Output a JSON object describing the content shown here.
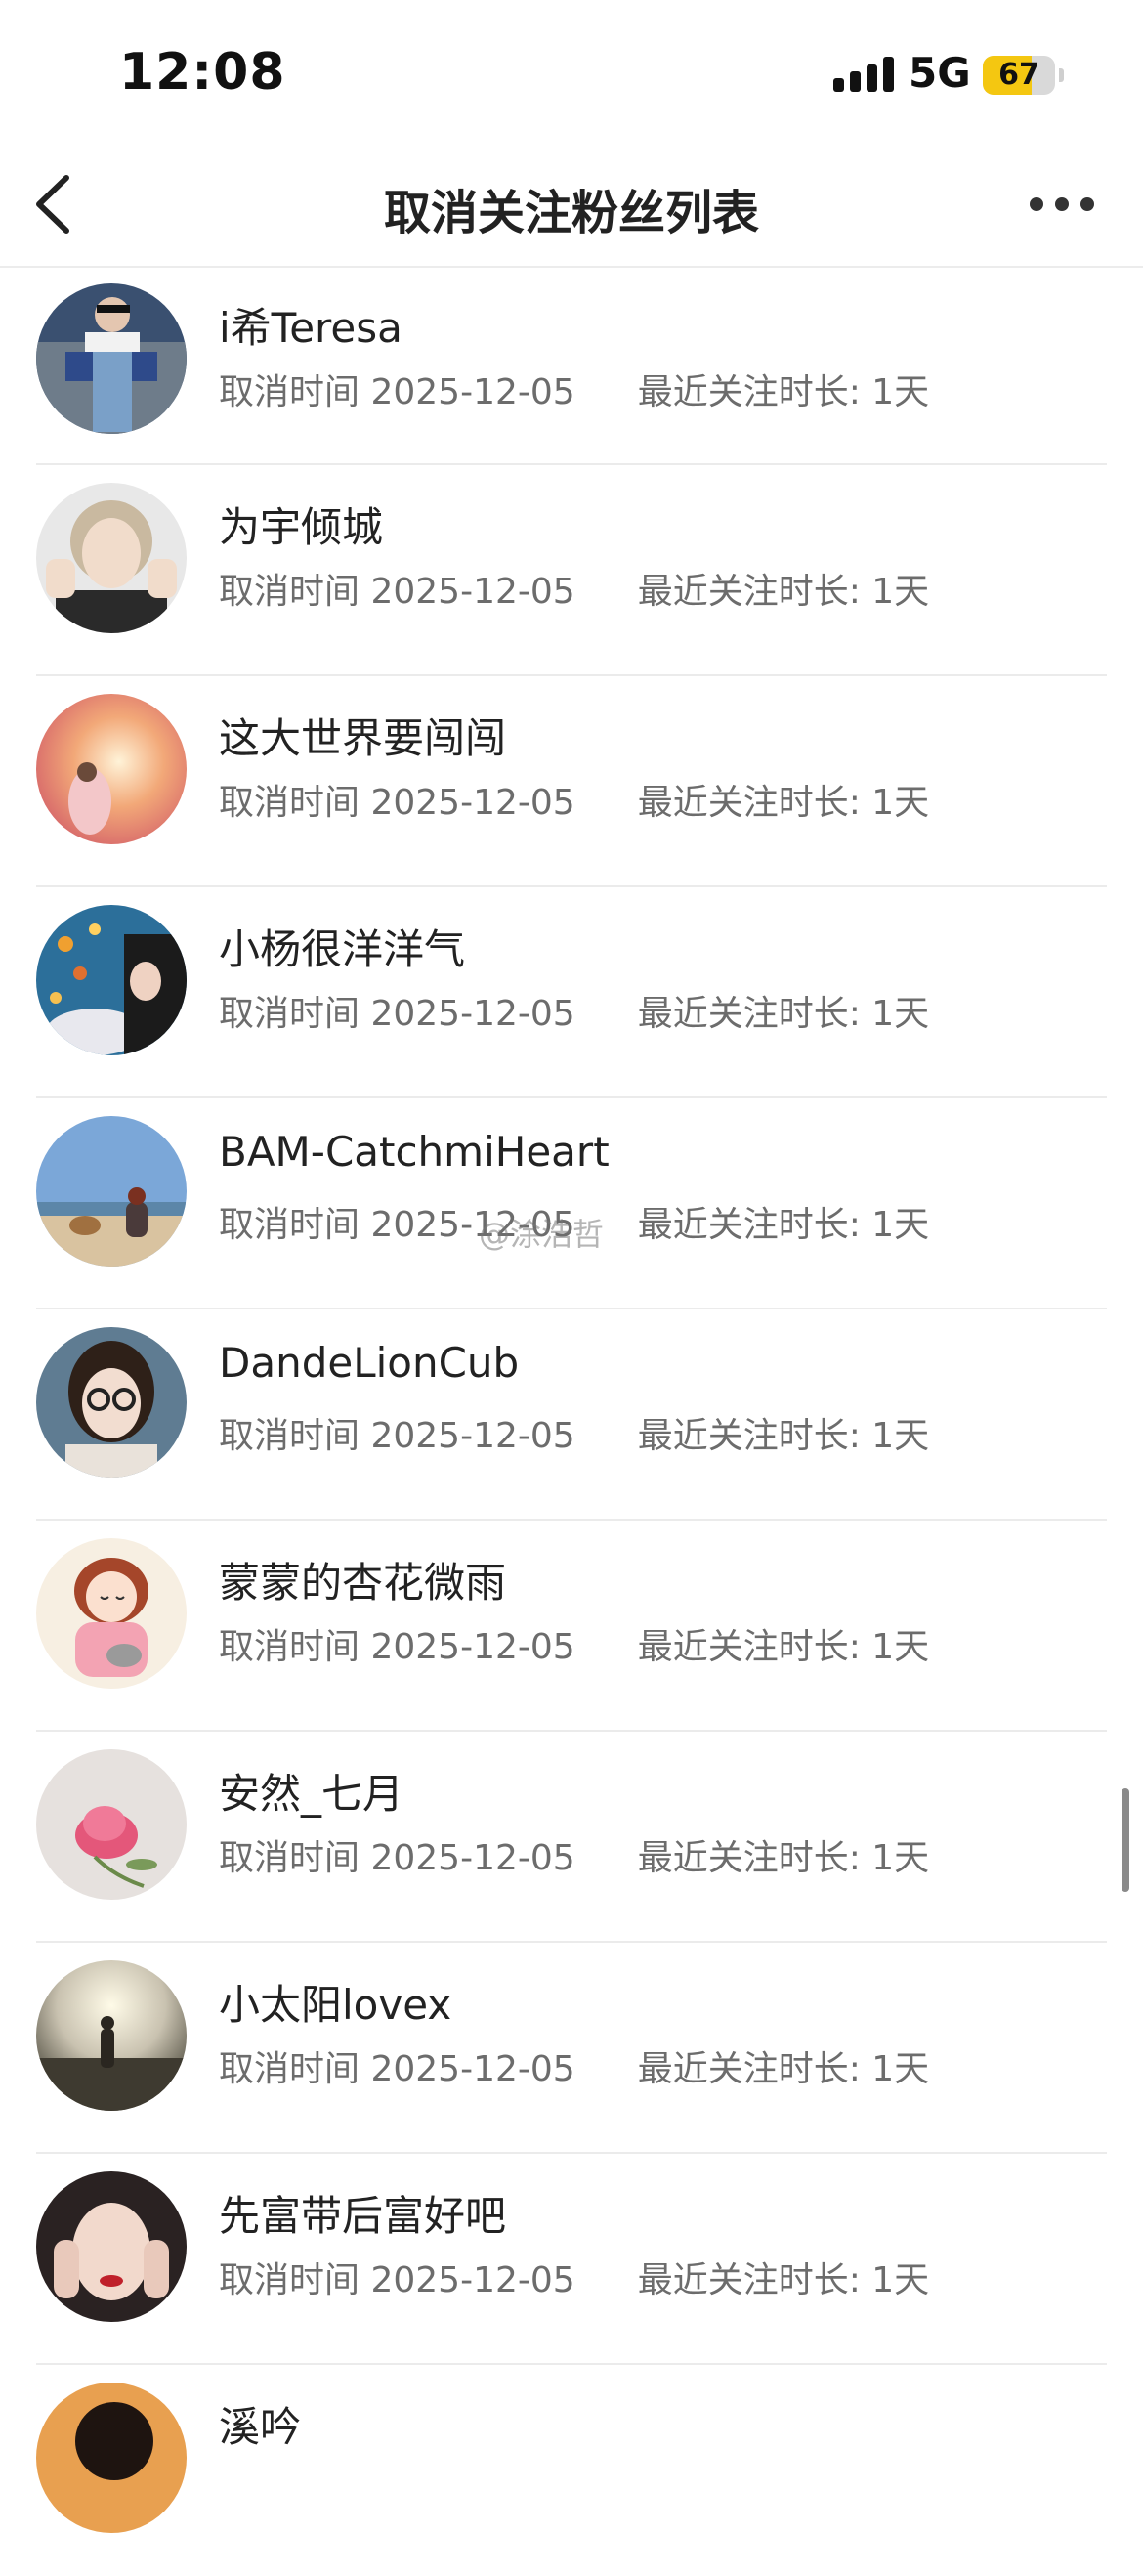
{
  "status_bar": {
    "time": "12:08",
    "network": "5G",
    "battery": "67",
    "battery_level": 0.67
  },
  "header": {
    "title": "取消关注粉丝列表",
    "back_icon": "chevron-left-icon",
    "more_icon": "more-dots-icon"
  },
  "list": {
    "items": [
      {
        "name": "i希Teresa",
        "cancel_label": "取消时间",
        "cancel_date": "2025-12-05",
        "duration_label": "最近关注时长:",
        "duration": "1天"
      },
      {
        "name": "为宇倾城",
        "cancel_label": "取消时间",
        "cancel_date": "2025-12-05",
        "duration_label": "最近关注时长:",
        "duration": "1天"
      },
      {
        "name": "这大世界要闯闯",
        "cancel_label": "取消时间",
        "cancel_date": "2025-12-05",
        "duration_label": "最近关注时长:",
        "duration": "1天"
      },
      {
        "name": "小杨很洋洋气",
        "cancel_label": "取消时间",
        "cancel_date": "2025-12-05",
        "duration_label": "最近关注时长:",
        "duration": "1天"
      },
      {
        "name": "BAM-CatchmiHeart",
        "cancel_label": "取消时间",
        "cancel_date": "2025-12-05",
        "duration_label": "最近关注时长:",
        "duration": "1天"
      },
      {
        "name": "DandeLionCub",
        "cancel_label": "取消时间",
        "cancel_date": "2025-12-05",
        "duration_label": "最近关注时长:",
        "duration": "1天"
      },
      {
        "name": "蒙蒙的杏花微雨",
        "cancel_label": "取消时间",
        "cancel_date": "2025-12-05",
        "duration_label": "最近关注时长:",
        "duration": "1天"
      },
      {
        "name": "安然_七月",
        "cancel_label": "取消时间",
        "cancel_date": "2025-12-05",
        "duration_label": "最近关注时长:",
        "duration": "1天"
      },
      {
        "name": "小太阳lovex",
        "cancel_label": "取消时间",
        "cancel_date": "2025-12-05",
        "duration_label": "最近关注时长:",
        "duration": "1天"
      },
      {
        "name": "先富带后富好吧",
        "cancel_label": "取消时间",
        "cancel_date": "2025-12-05",
        "duration_label": "最近关注时长:",
        "duration": "1天"
      },
      {
        "name": "溪吟"
      }
    ]
  },
  "watermark": "@涂浩哲",
  "colors": {
    "battery_fill": "#f4c711",
    "divider": "#ebebeb",
    "meta_text": "#6c6c6c",
    "title_text": "#222222"
  }
}
